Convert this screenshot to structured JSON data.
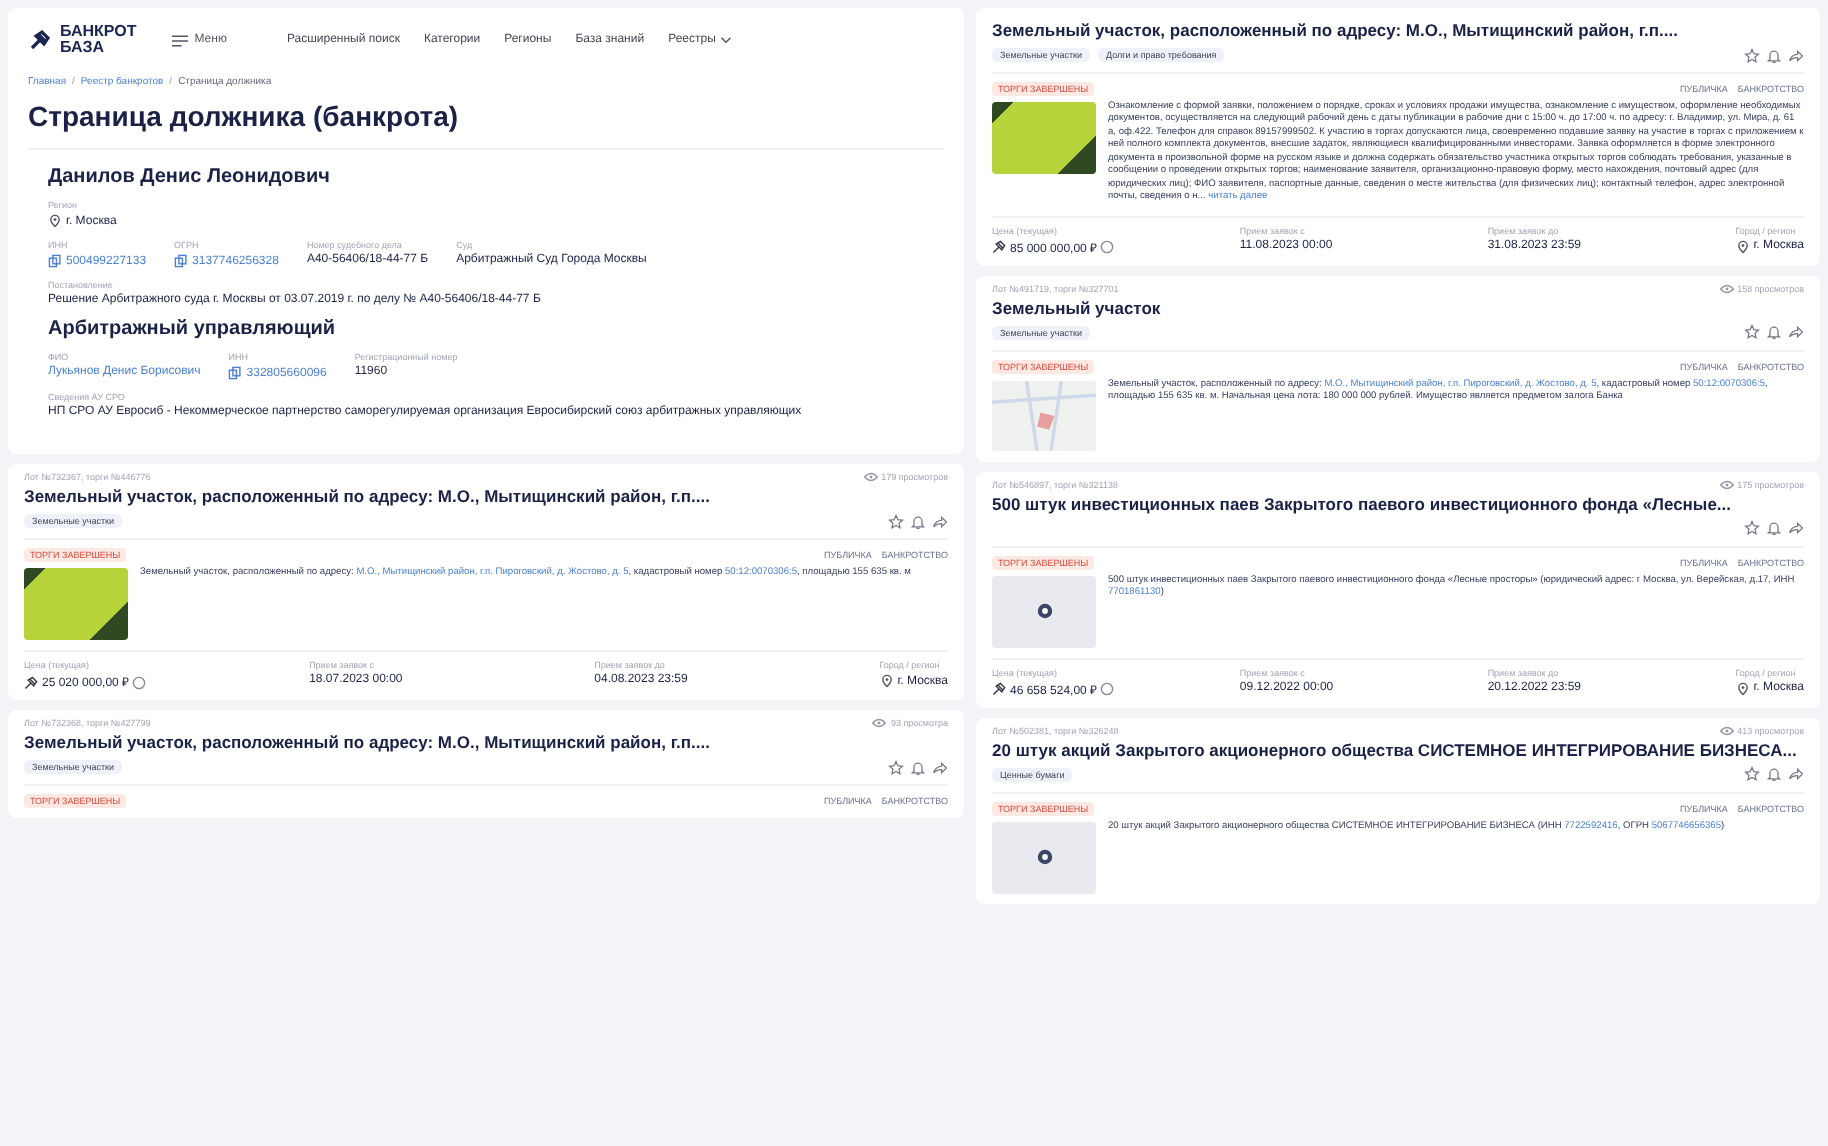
{
  "header": {
    "logo_lines": [
      "БАНКРОТ",
      "БАЗА"
    ],
    "menu": "Меню",
    "nav": [
      {
        "label": "Расширенный поиск",
        "dropdown": false
      },
      {
        "label": "Категории",
        "dropdown": false
      },
      {
        "label": "Регионы",
        "dropdown": false
      },
      {
        "label": "База знаний",
        "dropdown": false
      },
      {
        "label": "Реестры",
        "dropdown": true
      }
    ]
  },
  "breadcrumbs": [
    "Главная",
    "Реестр банкротов",
    "Страница должника"
  ],
  "breadcrumb_separator": "/",
  "page_title": "Страница должника (банкрота)",
  "debtor": {
    "name": "Данилов Денис Леонидович",
    "rows": [
      [
        {
          "label": "Регион",
          "value": "г. Москва",
          "kind": "location"
        }
      ],
      [
        {
          "label": "ИНН",
          "value": "500499227133",
          "kind": "copy"
        },
        {
          "label": "ОГРН",
          "value": "3137746256328",
          "kind": "copy"
        },
        {
          "label": "Номер судебного дела",
          "value": "А40-56406/18-44-77 Б",
          "kind": "text"
        },
        {
          "label": "Суд",
          "value": "Арбитражный Суд Города Москвы",
          "kind": "text"
        }
      ],
      [
        {
          "label": "Постановление",
          "value": "Решение Арбитражного суда г. Москвы от 03.07.2019 г. по делу № А40-56406/18-44-77 Б",
          "kind": "text"
        }
      ]
    ]
  },
  "arbitration_manager": {
    "heading": "Арбитражный управляющий",
    "rows": [
      [
        {
          "label": "ФИО",
          "value": "Лукьянов Денис Борисович",
          "kind": "link"
        },
        {
          "label": "ИНН",
          "value": "332805660096",
          "kind": "copy"
        },
        {
          "label": "Регистрационный номер",
          "value": "11960",
          "kind": "text"
        }
      ],
      [
        {
          "label": "Сведения АУ СРО",
          "value": "НП СРО АУ Евросиб - Некоммерческое партнерство саморегулируемая организация Евросибирский союз арбитражных управляющих",
          "kind": "text"
        }
      ]
    ]
  },
  "left_lots": [
    {
      "meta": "Лот №732367, торги №446776",
      "views": "179 просмотров",
      "title": "Земельный участок, расположенный по адресу: М.О., Мытищинский район, г.п....",
      "tags": [
        "Земельные участки"
      ],
      "status": "ТОРГИ ЗАВЕРШЕНЫ",
      "types": [
        "ПУБЛИЧКА",
        "БАНКРОТСТВО"
      ],
      "image": {
        "kind": "photo"
      },
      "description": [
        {
          "kind": "text",
          "text": "Земельный участок, расположенный по адресу: "
        },
        {
          "kind": "link",
          "text": "М.О., Мытищинский район, г.п. Пироговский, д. Жостово, д. 5"
        },
        {
          "kind": "text",
          "text": ", кадастровый номер "
        },
        {
          "kind": "link",
          "text": "50:12:0070306:5"
        },
        {
          "kind": "text",
          "text": ", площадью 155 635 кв. м"
        }
      ],
      "footer": [
        {
          "label": "Цена (текущая)",
          "value": "25 020 000,00 ₽",
          "kind": "price"
        },
        {
          "label": "Прием заявок с",
          "value": "18.07.2023 00:00",
          "kind": "text"
        },
        {
          "label": "Прием заявок до",
          "value": "04.08.2023 23:59",
          "kind": "text"
        },
        {
          "label": "Город / регион",
          "value": "г. Москва",
          "kind": "location"
        }
      ]
    },
    {
      "meta": "Лот №732368, торги №427799",
      "views": "93 просмотра",
      "title": "Земельный участок, расположенный по адресу: М.О., Мытищинский район, г.п....",
      "tags": [
        "Земельные участки"
      ],
      "status": "ТОРГИ ЗАВЕРШЕНЫ",
      "types": [
        "ПУБЛИЧКА",
        "БАНКРОТСТВО"
      ]
    }
  ],
  "right_lots": [
    {
      "title": "Земельный участок, расположенный по адресу: М.О., Мытищинский район, г.п....",
      "tags": [
        "Земельные участки",
        "Долги и право требования"
      ],
      "status": "ТОРГИ ЗАВЕРШЕНЫ",
      "types": [
        "ПУБЛИЧКА",
        "БАНКРОТСТВО"
      ],
      "image": {
        "kind": "photo"
      },
      "description": [
        {
          "kind": "text",
          "text": "Ознакомление с формой заявки, положением о порядке, сроках и условиях продажи имущества, ознакомление с имуществом, оформление необходимых документов, осуществляется на следующий рабочий день с даты публикации в рабочие дни с 15:00 ч. до 17:00 ч. по адресу: г. Владимир, ул. Мира, д. 61 а, оф.422. Телефон для справок 89157999502. К участию в торгах допускаются лица, своевременно подавшие заявку на участие в торгах с приложением к ней полного комплекта документов, внесшие задаток, являющиеся квалифицированными инвесторами. Заявка оформляется в форме электронного документа в произвольной форме на русском языке и должна содержать обязательство участника открытых торгов соблюдать требования, указанные в сообщении о проведении открытых торгов; наименование заявителя, организационно-правовую форму, место нахождения, почтовый адрес (для юридических лиц); ФИО заявителя, паспортные данные, сведения о месте жительства (для физических лиц); контактный телефон, адрес электронной почты, сведения о н... "
        },
        {
          "kind": "link",
          "text": "читать далее"
        }
      ],
      "footer": [
        {
          "label": "Цена (текущая)",
          "value": "85 000 000,00 ₽",
          "kind": "price"
        },
        {
          "label": "Прием заявок с",
          "value": "11.08.2023 00:00",
          "kind": "text"
        },
        {
          "label": "Прием заявок до",
          "value": "31.08.2023 23:59",
          "kind": "text"
        },
        {
          "label": "Город / регион",
          "value": "г. Москва",
          "kind": "location"
        }
      ]
    },
    {
      "meta": "Лот №491719, торги №327701",
      "views": "158 просмотров",
      "title": "Земельный участок",
      "tags": [
        "Земельные участки"
      ],
      "status": "ТОРГИ ЗАВЕРШЕНЫ",
      "types": [
        "ПУБЛИЧКА",
        "БАНКРОТСТВО"
      ],
      "image": {
        "kind": "map"
      },
      "description": [
        {
          "kind": "text",
          "text": "Земельный участок, расположенный по адресу: "
        },
        {
          "kind": "link",
          "text": "М.О., Мытищинский район, г.п. Пироговский, д. Жостово, д. 5"
        },
        {
          "kind": "text",
          "text": ", кадастровый номер "
        },
        {
          "kind": "link",
          "text": "50:12:0070306:5"
        },
        {
          "kind": "text",
          "text": ", площадью 155 635 кв. м. Начальная цена лота: 180 000 000 рублей. Имущество является предметом залога Банка"
        }
      ]
    },
    {
      "meta": "Лот №546897, торги №321138",
      "views": "175 просмотров",
      "title": "500 штук инвестиционных паев Закрытого паевого инвестиционного фонда «Лесные...",
      "status": "ТОРГИ ЗАВЕРШЕНЫ",
      "types": [
        "ПУБЛИЧКА",
        "БАНКРОТСТВО"
      ],
      "image": {
        "kind": "empty"
      },
      "description": [
        {
          "kind": "text",
          "text": "500 штук инвестиционных паев Закрытого паевого инвестиционного фонда «Лесные просторы» (юридический адрес: г Москва, ул. Верейская, д.17, ИНН "
        },
        {
          "kind": "link",
          "text": "7701861130"
        },
        {
          "kind": "text",
          "text": ")"
        }
      ],
      "footer": [
        {
          "label": "Цена (текущая)",
          "value": "46 658 524,00 ₽",
          "kind": "price"
        },
        {
          "label": "Прием заявок с",
          "value": "09.12.2022 00:00",
          "kind": "text"
        },
        {
          "label": "Прием заявок до",
          "value": "20.12.2022 23:59",
          "kind": "text"
        },
        {
          "label": "Город / регион",
          "value": "г. Москва",
          "kind": "location"
        }
      ]
    },
    {
      "meta": "Лот №502381, торги №326248",
      "views": "413 просмотров",
      "title": "20 штук акций Закрытого акционерного общества СИСТЕМНОЕ ИНТЕГРИРОВАНИЕ БИЗНЕСА...",
      "tags": [
        "Ценные бумаги"
      ],
      "status": "ТОРГИ ЗАВЕРШЕНЫ",
      "types": [
        "ПУБЛИЧКА",
        "БАНКРОТСТВО"
      ],
      "image": {
        "kind": "empty"
      },
      "description": [
        {
          "kind": "text",
          "text": "20 штук акций Закрытого акционерного общества СИСТЕМНОЕ ИНТЕГРИРОВАНИЕ БИЗНЕСА (ИНН "
        },
        {
          "kind": "link",
          "text": "7722592416"
        },
        {
          "kind": "text",
          "text": ", ОГРН "
        },
        {
          "kind": "link",
          "text": "5067746656365"
        },
        {
          "kind": "text",
          "text": ")"
        }
      ]
    }
  ]
}
